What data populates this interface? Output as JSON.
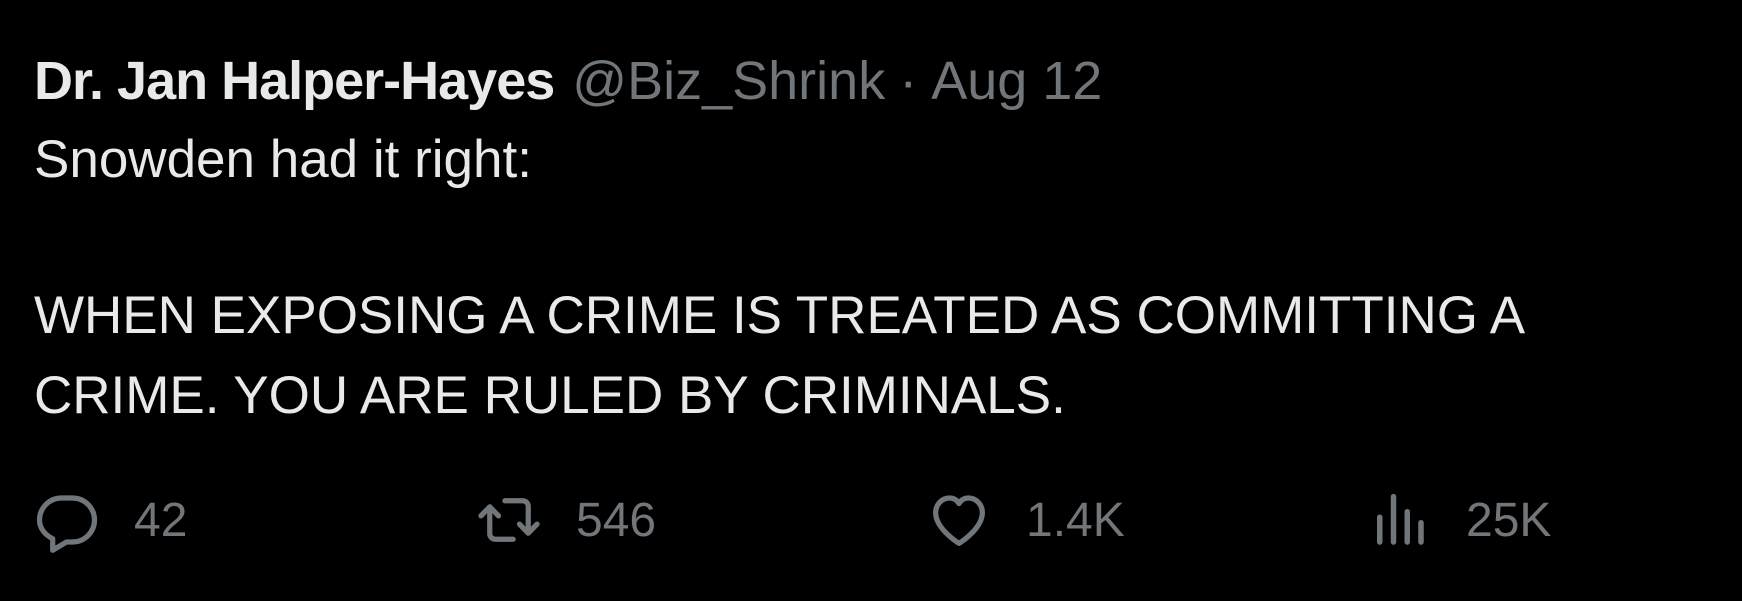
{
  "tweet": {
    "author": {
      "display_name": "Dr. Jan Halper-Hayes",
      "handle": "@Biz_Shrink"
    },
    "separator": "·",
    "date": "Aug 12",
    "text_lines": [
      "Snowden had it right:",
      "WHEN EXPOSING A CRIME IS TREATED AS COMMITTING A",
      "CRIME. YOU ARE RULED BY CRIMINALS."
    ]
  },
  "actions": {
    "reply": {
      "icon": "reply-icon",
      "count": "42"
    },
    "retweet": {
      "icon": "retweet-icon",
      "count": "546"
    },
    "like": {
      "icon": "heart-icon",
      "count": "1.4K"
    },
    "views": {
      "icon": "views-chart-icon",
      "count": "25K"
    }
  },
  "colors": {
    "background": "#000000",
    "primary_text": "#e7e9ea",
    "secondary_text": "#71767b"
  }
}
